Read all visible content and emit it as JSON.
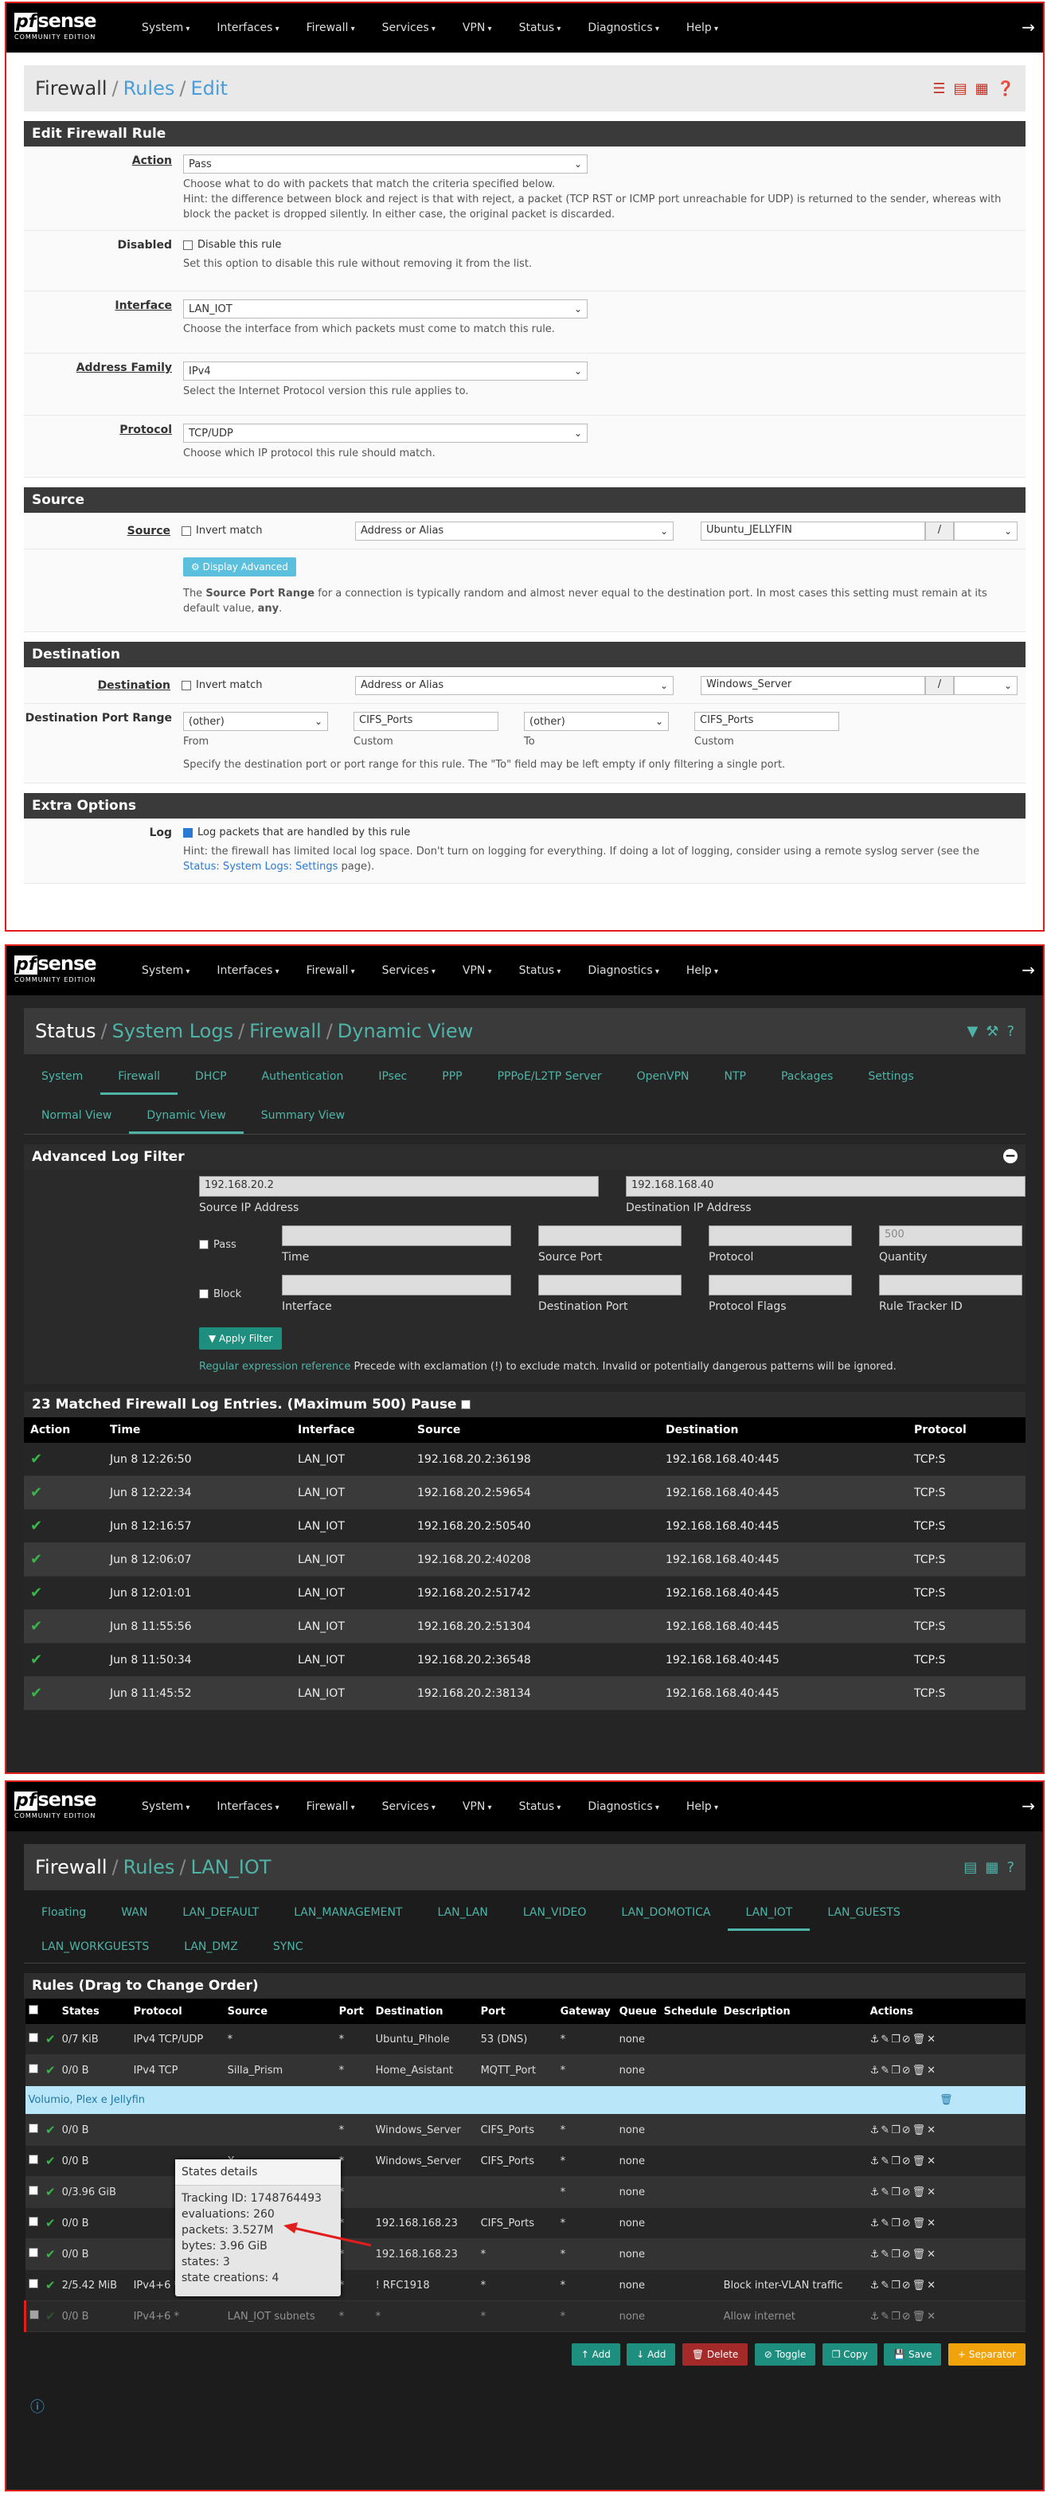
{
  "nav": {
    "items": [
      "System",
      "Interfaces",
      "Firewall",
      "Services",
      "VPN",
      "Status",
      "Diagnostics",
      "Help"
    ],
    "logo_pf": "pf",
    "logo_sense": "sense",
    "logo_ce": "COMMUNITY EDITION"
  },
  "s1": {
    "bc": [
      "Firewall",
      "Rules",
      "Edit"
    ],
    "panel_edit": "Edit Firewall Rule",
    "action_label": "Action",
    "action_value": "Pass",
    "action_help1": "Choose what to do with packets that match the criteria specified below.",
    "action_help2": "Hint: the difference between block and reject is that with reject, a packet (TCP RST or ICMP port unreachable for UDP) is returned to the sender, whereas with block the packet is dropped silently. In either case, the original packet is discarded.",
    "disabled_label": "Disabled",
    "disabled_cb": "Disable this rule",
    "disabled_help": "Set this option to disable this rule without removing it from the list.",
    "iface_label": "Interface",
    "iface_value": "LAN_IOT",
    "iface_help": "Choose the interface from which packets must come to match this rule.",
    "af_label": "Address Family",
    "af_value": "IPv4",
    "af_help": "Select the Internet Protocol version this rule applies to.",
    "proto_label": "Protocol",
    "proto_value": "TCP/UDP",
    "proto_help": "Choose which IP protocol this rule should match.",
    "panel_source": "Source",
    "src_label": "Source",
    "invert": "Invert match",
    "addr_alias": "Address or Alias",
    "src_value": "Ubuntu_JELLYFIN",
    "slash": "/",
    "adv_btn": "Display Advanced",
    "src_help_pre": "The ",
    "src_help_b": "Source Port Range",
    "src_help_post": " for a connection is typically random and almost never equal to the destination port. In most cases this setting must remain at its default value, ",
    "src_help_any": "any",
    "panel_dest": "Destination",
    "dst_label": "Destination",
    "dst_value": "Windows_Server",
    "dpr_label": "Destination Port Range",
    "other": "(other)",
    "cifs": "CIFS_Ports",
    "from": "From",
    "custom": "Custom",
    "to": "To",
    "dpr_help": "Specify the destination port or port range for this rule. The \"To\" field may be left empty if only filtering a single port.",
    "panel_extra": "Extra Options",
    "log_label": "Log",
    "log_cb": "Log packets that are handled by this rule",
    "log_help1": "Hint: the firewall has limited local log space. Don't turn on logging for everything. If doing a lot of logging, consider using a remote syslog server (see the ",
    "log_link": "Status: System Logs: Settings",
    "log_help2": " page)."
  },
  "s2": {
    "bc": [
      "Status",
      "System Logs",
      "Firewall",
      "Dynamic View"
    ],
    "tabs": [
      "System",
      "Firewall",
      "DHCP",
      "Authentication",
      "IPsec",
      "PPP",
      "PPPoE/L2TP Server",
      "OpenVPN",
      "NTP",
      "Packages",
      "Settings"
    ],
    "subtabs": [
      "Normal View",
      "Dynamic View",
      "Summary View"
    ],
    "filter_title": "Advanced Log Filter",
    "src_ip": "192.168.20.2",
    "src_ip_label": "Source IP Address",
    "dst_ip": "192.168.168.40",
    "dst_ip_label": "Destination IP Address",
    "pass": "Pass",
    "block": "Block",
    "time": "Time",
    "sport": "Source Port",
    "protocol": "Protocol",
    "quantity": "Quantity",
    "qty_ph": "500",
    "interface": "Interface",
    "dport": "Destination Port",
    "pflags": "Protocol Flags",
    "rtid": "Rule Tracker ID",
    "apply": "Apply Filter",
    "regex": "Regular expression reference",
    "regex_help": " Precede with exclamation (!) to exclude match. Invalid or potentially dangerous patterns will be ignored.",
    "matched": "23 Matched Firewall Log Entries. (Maximum 500) Pause",
    "cols": [
      "Action",
      "Time",
      "Interface",
      "Source",
      "Destination",
      "Protocol"
    ],
    "rows": [
      [
        "Jun 8 12:26:50",
        "LAN_IOT",
        "192.168.20.2:36198",
        "192.168.168.40:445",
        "TCP:S"
      ],
      [
        "Jun 8 12:22:34",
        "LAN_IOT",
        "192.168.20.2:59654",
        "192.168.168.40:445",
        "TCP:S"
      ],
      [
        "Jun 8 12:16:57",
        "LAN_IOT",
        "192.168.20.2:50540",
        "192.168.168.40:445",
        "TCP:S"
      ],
      [
        "Jun 8 12:06:07",
        "LAN_IOT",
        "192.168.20.2:40208",
        "192.168.168.40:445",
        "TCP:S"
      ],
      [
        "Jun 8 12:01:01",
        "LAN_IOT",
        "192.168.20.2:51742",
        "192.168.168.40:445",
        "TCP:S"
      ],
      [
        "Jun 8 11:55:56",
        "LAN_IOT",
        "192.168.20.2:51304",
        "192.168.168.40:445",
        "TCP:S"
      ],
      [
        "Jun 8 11:50:34",
        "LAN_IOT",
        "192.168.20.2:36548",
        "192.168.168.40:445",
        "TCP:S"
      ],
      [
        "Jun 8 11:45:52",
        "LAN_IOT",
        "192.168.20.2:38134",
        "192.168.168.40:445",
        "TCP:S"
      ]
    ]
  },
  "s3": {
    "bc": [
      "Firewall",
      "Rules",
      "LAN_IOT"
    ],
    "tabs1": [
      "Floating",
      "WAN",
      "LAN_DEFAULT",
      "LAN_MANAGEMENT",
      "LAN_LAN",
      "LAN_VIDEO",
      "LAN_DOMOTICA",
      "LAN_IOT",
      "LAN_GUESTS"
    ],
    "tabs2": [
      "LAN_WORKGUESTS",
      "LAN_DMZ",
      "SYNC"
    ],
    "rules_title": "Rules (Drag to Change Order)",
    "cols": [
      "",
      "",
      "States",
      "Protocol",
      "Source",
      "Port",
      "Destination",
      "Port",
      "Gateway",
      "Queue",
      "Schedule",
      "Description",
      "Actions"
    ],
    "r1": [
      "0/7 KiB",
      "IPv4 TCP/UDP",
      "*",
      "*",
      "Ubuntu_Pihole",
      "53 (DNS)",
      "*",
      "none",
      ""
    ],
    "r2": [
      "0/0 B",
      "IPv4 TCP",
      "Silla_Prism",
      "*",
      "Home_Asistant",
      "MQTT_Port",
      "*",
      "none",
      ""
    ],
    "separator": "Volumio, Plex e Jellyfin",
    "r3": [
      "0/0 B",
      "",
      "",
      "*",
      "Windows_Server",
      "CIFS_Ports",
      "*",
      "none",
      ""
    ],
    "r4": [
      "0/0 B",
      "",
      "X",
      "*",
      "Windows_Server",
      "CIFS_Ports",
      "*",
      "none",
      ""
    ],
    "r5": [
      "0/3.96 GiB",
      "",
      "",
      "*",
      "",
      "",
      "*",
      "none",
      ""
    ],
    "r6": [
      "0/0 B",
      "",
      "X",
      "*",
      "192.168.168.23",
      "CIFS_Ports",
      "*",
      "none",
      ""
    ],
    "r7": [
      "0/0 B",
      "",
      "X",
      "*",
      "192.168.168.23",
      "*",
      "*",
      "none",
      ""
    ],
    "any": "any",
    "r8": [
      "2/5.42 MiB",
      "IPv4+6 *",
      "LAN_IOT subnets",
      "*",
      "! RFC1918",
      "*",
      "*",
      "none",
      "Block inter-VLAN traffic"
    ],
    "r9": [
      "0/0 B",
      "IPv4+6 *",
      "LAN_IOT subnets",
      "*",
      "*",
      "*",
      "*",
      "none",
      "Allow internet"
    ],
    "tooltip_title": "States details",
    "tooltip_lines": [
      "Tracking ID: 1748764493",
      "evaluations: 260",
      "packets: 3.527M",
      "bytes: 3.96 GiB",
      "states: 3",
      "state creations: 4"
    ],
    "buttons": [
      "Add",
      "Add",
      "Delete",
      "Toggle",
      "Copy",
      "Save",
      "Separator"
    ]
  }
}
